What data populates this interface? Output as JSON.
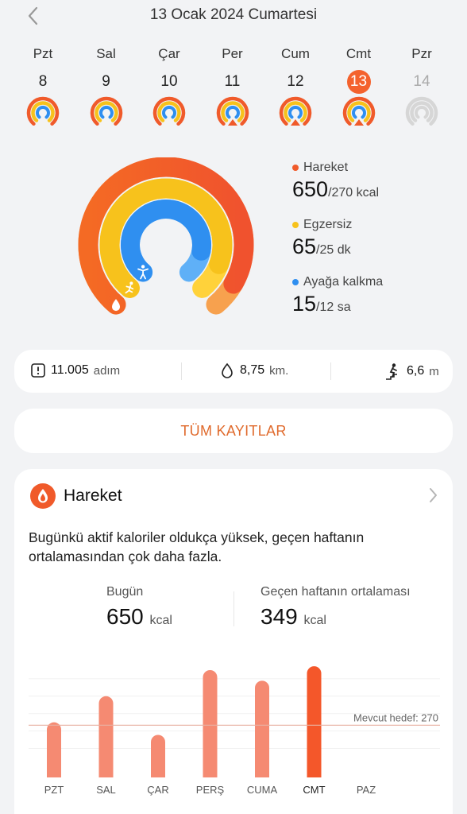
{
  "header": {
    "title": "13 Ocak 2024 Cumartesi"
  },
  "week": [
    {
      "name": "Pzt",
      "num": "8",
      "state": "normal"
    },
    {
      "name": "Sal",
      "num": "9",
      "state": "normal"
    },
    {
      "name": "Çar",
      "num": "10",
      "state": "normal"
    },
    {
      "name": "Per",
      "num": "11",
      "state": "normal"
    },
    {
      "name": "Cum",
      "num": "12",
      "state": "normal"
    },
    {
      "name": "Cmt",
      "num": "13",
      "state": "selected"
    },
    {
      "name": "Pzr",
      "num": "14",
      "state": "future"
    }
  ],
  "rings": {
    "colors": {
      "move": "#f05a2a",
      "exercise": "#f7c21c",
      "stand": "#2f8ff0"
    },
    "move": {
      "label": "Hareket",
      "value": "650",
      "goal": "/270 kcal"
    },
    "exercise": {
      "label": "Egzersiz",
      "value": "65",
      "goal": "/25 dk"
    },
    "stand": {
      "label": "Ayağa kalkma",
      "value": "15",
      "goal": "/12 sa"
    }
  },
  "stats": {
    "steps": {
      "value": "11.005",
      "unit": "adım"
    },
    "distance": {
      "value": "8,75",
      "unit": "km."
    },
    "climb": {
      "value": "6,6",
      "unit": "m"
    }
  },
  "all_records": "TÜM KAYITLAR",
  "card": {
    "title": "Hareket",
    "description": "Bugünkü aktif kaloriler oldukça yüksek, geçen haftanın ortalamasından çok daha fazla.",
    "today": {
      "label": "Bugün",
      "value": "650",
      "unit": "kcal"
    },
    "avg": {
      "label": "Geçen haftanın ortalaması",
      "value": "349",
      "unit": "kcal"
    }
  },
  "chart_data": {
    "type": "bar",
    "categories": [
      "PZT",
      "SAL",
      "ÇAR",
      "PERŞ",
      "CUMA",
      "CMT",
      "PAZ"
    ],
    "values": [
      285,
      420,
      220,
      555,
      500,
      575,
      0
    ],
    "highlight_index": 5,
    "goal_label": "Mevcut hedef: 270",
    "goal_value": 270,
    "ylim": [
      0,
      600
    ],
    "colors": {
      "bar": "#f58a72",
      "highlight": "#f4572a",
      "goal_line": "#e8b1a2"
    }
  }
}
